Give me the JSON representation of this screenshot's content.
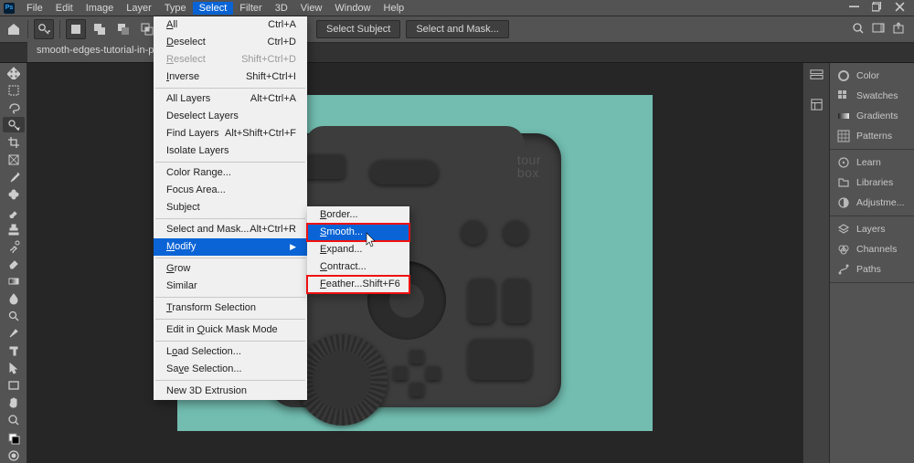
{
  "app": {
    "name": "Photoshop"
  },
  "menubar": {
    "items": [
      "File",
      "Edit",
      "Image",
      "Layer",
      "Type",
      "Select",
      "Filter",
      "3D",
      "View",
      "Window",
      "Help"
    ],
    "active_index": 5
  },
  "optionsbar": {
    "select_subject": "Select Subject",
    "select_and_mask": "Select and Mask..."
  },
  "document": {
    "tab_label": "smooth-edges-tutorial-in-phot..."
  },
  "canvas_image": {
    "device_logo_line1": "tour",
    "device_logo_line2": "box"
  },
  "dropdown": {
    "items": [
      {
        "label": "All",
        "u": "A",
        "shortcut": "Ctrl+A"
      },
      {
        "label": "Deselect",
        "u": "D",
        "shortcut": "Ctrl+D"
      },
      {
        "label": "Reselect",
        "u": "R",
        "shortcut": "Shift+Ctrl+D",
        "disabled": true
      },
      {
        "label": "Inverse",
        "u": "I",
        "shortcut": "Shift+Ctrl+I"
      },
      {
        "sep": true
      },
      {
        "label": "All Layers",
        "u": "",
        "shortcut": "Alt+Ctrl+A"
      },
      {
        "label": "Deselect Layers",
        "u": "",
        "shortcut": ""
      },
      {
        "label": "Find Layers",
        "u": "",
        "shortcut": "Alt+Shift+Ctrl+F"
      },
      {
        "label": "Isolate Layers",
        "u": "",
        "shortcut": ""
      },
      {
        "sep": true
      },
      {
        "label": "Color Range...",
        "u": "",
        "shortcut": ""
      },
      {
        "label": "Focus Area...",
        "u": "",
        "shortcut": ""
      },
      {
        "label": "Subject",
        "u": "",
        "shortcut": ""
      },
      {
        "sep": true
      },
      {
        "label": "Select and Mask...",
        "u": "",
        "shortcut": "Alt+Ctrl+R"
      },
      {
        "label": "Modify",
        "u": "M",
        "shortcut": "",
        "arrow": true,
        "highlight": true
      },
      {
        "sep": true
      },
      {
        "label": "Grow",
        "u": "G",
        "shortcut": ""
      },
      {
        "label": "Similar",
        "u": "",
        "shortcut": ""
      },
      {
        "sep": true
      },
      {
        "label": "Transform Selection",
        "u": "T",
        "shortcut": ""
      },
      {
        "sep": true
      },
      {
        "label": "Edit in Quick Mask Mode",
        "u": "Q",
        "shortcut": ""
      },
      {
        "sep": true
      },
      {
        "label": "Load Selection...",
        "u": "o",
        "shortcut": ""
      },
      {
        "label": "Save Selection...",
        "u": "v",
        "shortcut": ""
      },
      {
        "sep": true
      },
      {
        "label": "New 3D Extrusion",
        "u": "",
        "shortcut": ""
      }
    ]
  },
  "submenu": {
    "items": [
      {
        "label": "Border...",
        "u": "B",
        "shortcut": ""
      },
      {
        "label": "Smooth...",
        "u": "S",
        "shortcut": "",
        "highlight": true,
        "redbox": true
      },
      {
        "label": "Expand...",
        "u": "E",
        "shortcut": ""
      },
      {
        "label": "Contract...",
        "u": "C",
        "shortcut": ""
      },
      {
        "label": "Feather...",
        "u": "F",
        "shortcut": "Shift+F6",
        "redbox": true
      }
    ]
  },
  "right_panels": {
    "group1": [
      {
        "icon": "color",
        "label": "Color"
      },
      {
        "icon": "swatches",
        "label": "Swatches"
      },
      {
        "icon": "gradients",
        "label": "Gradients"
      },
      {
        "icon": "patterns",
        "label": "Patterns"
      }
    ],
    "group2": [
      {
        "icon": "learn",
        "label": "Learn"
      },
      {
        "icon": "libraries",
        "label": "Libraries"
      },
      {
        "icon": "adjust",
        "label": "Adjustme..."
      }
    ],
    "group3": [
      {
        "icon": "layers",
        "label": "Layers"
      },
      {
        "icon": "channels",
        "label": "Channels"
      },
      {
        "icon": "paths",
        "label": "Paths"
      }
    ]
  },
  "left_tools": [
    "move",
    "marquee",
    "lasso",
    "quick-select",
    "crop",
    "frame",
    "eyedropper",
    "heal",
    "brush",
    "stamp",
    "history-brush",
    "eraser",
    "gradient",
    "blur",
    "dodge",
    "pen",
    "type",
    "path-select",
    "rectangle",
    "hand",
    "zoom",
    "colors",
    "quickmask"
  ]
}
